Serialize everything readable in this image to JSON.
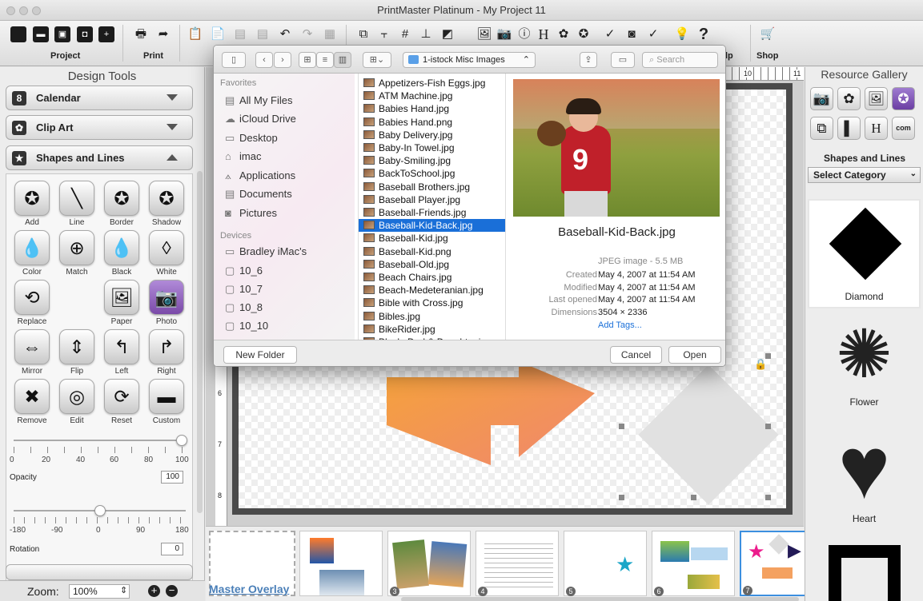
{
  "window": {
    "title": "PrintMaster Platinum - My Project 11"
  },
  "toolbar": {
    "project_label": "Project",
    "print_label": "Print",
    "help_fragment": "lp",
    "shop_label": "Shop"
  },
  "design_tools": {
    "title": "Design Tools",
    "sections": {
      "calendar": "Calendar",
      "clipart": "Clip Art",
      "shapes": "Shapes and Lines"
    },
    "tools": [
      "Add",
      "Line",
      "Border",
      "Shadow",
      "Color",
      "Match",
      "Black",
      "White",
      "Replace",
      "Paper",
      "Photo",
      "Mirror",
      "Flip",
      "Left",
      "Right",
      "Remove",
      "Edit",
      "Reset",
      "Custom"
    ],
    "opacity": {
      "label": "Opacity",
      "value": "100",
      "ticks": [
        "0",
        "20",
        "40",
        "60",
        "80",
        "100"
      ]
    },
    "rotation": {
      "label": "Rotation",
      "value": "0",
      "ticks": [
        "-180",
        "-90",
        "0",
        "90",
        "180"
      ]
    },
    "zoom": {
      "label": "Zoom:",
      "value": "100%"
    }
  },
  "ruler": {
    "left_marks": [
      "6",
      "7",
      "8"
    ],
    "top_marks": [
      "10",
      "11"
    ]
  },
  "filmstrip": {
    "master_label": "Master Overlay",
    "page_numbers": [
      "3",
      "4",
      "5",
      "6",
      "7"
    ]
  },
  "gallery": {
    "title": "Resource Gallery",
    "section": "Shapes and Lines",
    "category": "Select Category",
    "shape_icon_text": "H",
    "com_icon_text": "com",
    "items": [
      "Diamond",
      "Flower",
      "Heart"
    ]
  },
  "dialog": {
    "location": "1-istock Misc Images",
    "search_placeholder": "Search",
    "favorites_header": "Favorites",
    "favorites": [
      "All My Files",
      "iCloud Drive",
      "Desktop",
      "imac",
      "Applications",
      "Documents",
      "Pictures"
    ],
    "devices_header": "Devices",
    "devices": [
      "Bradley iMac's",
      "10_6",
      "10_7",
      "10_8",
      "10_10"
    ],
    "files": [
      "Appetizers-Fish Eggs.jpg",
      "ATM Machine.jpg",
      "Babies Hand.jpg",
      "Babies Hand.png",
      "Baby Delivery.jpg",
      "Baby-In Towel.jpg",
      "Baby-Smiling.jpg",
      "BackToSchool.jpg",
      "Baseball Brothers.jpg",
      "Baseball Player.jpg",
      "Baseball-Friends.jpg",
      "Baseball-Kid-Back.jpg",
      "Baseball-Kid.jpg",
      "Baseball-Kid.png",
      "Baseball-Old.jpg",
      "Beach Chairs.jpg",
      "Beach-Medeteranian.jpg",
      "Bible with Cross.jpg",
      "Bibles.jpg",
      "BikeRider.jpg",
      "Black, Dad & Daughter.jpg"
    ],
    "selected_index": 11,
    "preview": {
      "filename": "Baseball-Kid-Back.jpg",
      "jersey_number": "9",
      "kind": "JPEG image - 5.5 MB",
      "created_label": "Created",
      "created": "May 4, 2007 at 11:54 AM",
      "modified_label": "Modified",
      "modified": "May 4, 2007 at 11:54 AM",
      "opened_label": "Last opened",
      "opened": "May 4, 2007 at 11:54 AM",
      "dimensions_label": "Dimensions",
      "dimensions": "3504 × 2336",
      "tags_link": "Add Tags..."
    },
    "new_folder": "New Folder",
    "cancel": "Cancel",
    "open": "Open"
  }
}
